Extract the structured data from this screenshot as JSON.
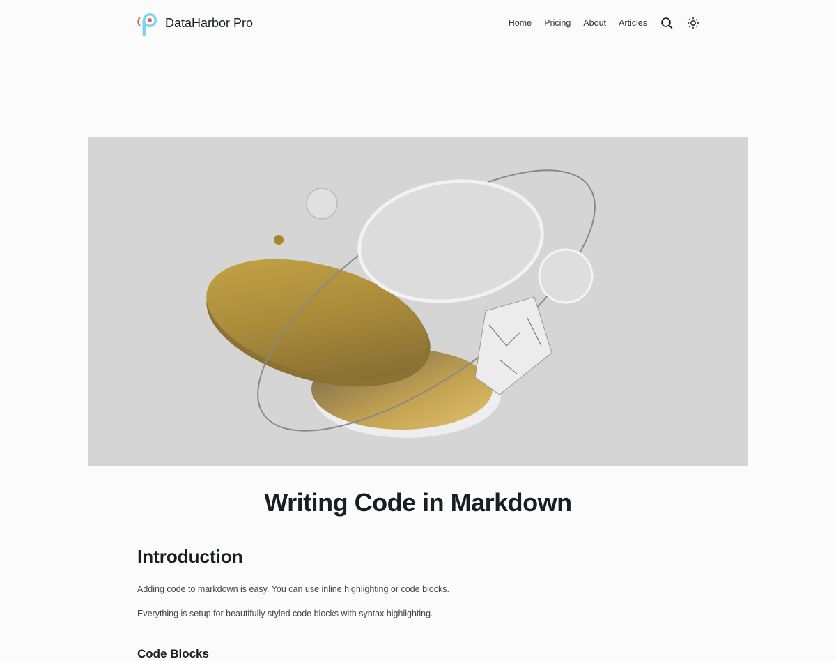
{
  "brand": {
    "name": "DataHarbor Pro"
  },
  "nav": {
    "items": [
      {
        "label": "Home"
      },
      {
        "label": "Pricing"
      },
      {
        "label": "About"
      },
      {
        "label": "Articles"
      }
    ],
    "search_icon": "search-icon",
    "theme_icon": "sun-icon"
  },
  "article": {
    "title": "Writing Code in Markdown",
    "intro_heading": "Introduction",
    "paragraphs": [
      "Adding code to markdown is easy. You can use inline highlighting or code blocks.",
      "Everything is setup for beautifully styled code blocks with syntax highlighting."
    ],
    "code_blocks_heading": "Code Blocks"
  }
}
